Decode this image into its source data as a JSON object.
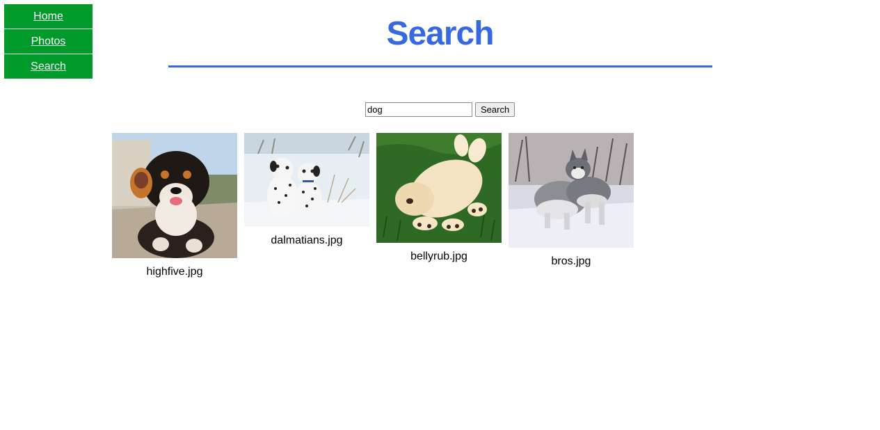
{
  "nav": {
    "items": [
      {
        "label": "Home"
      },
      {
        "label": "Photos"
      },
      {
        "label": "Search"
      }
    ]
  },
  "header": {
    "title": "Search"
  },
  "search": {
    "value": "dog",
    "button_label": "Search"
  },
  "results": [
    {
      "filename": "highfive.jpg",
      "icon": "puppy-high-five-photo"
    },
    {
      "filename": "dalmatians.jpg",
      "icon": "dalmatian-puppies-photo"
    },
    {
      "filename": "bellyrub.jpg",
      "icon": "puppy-bellyrub-photo"
    },
    {
      "filename": "bros.jpg",
      "icon": "husky-puppies-photo"
    }
  ],
  "colors": {
    "nav_bg": "#009a2b",
    "accent": "#3868e0"
  }
}
